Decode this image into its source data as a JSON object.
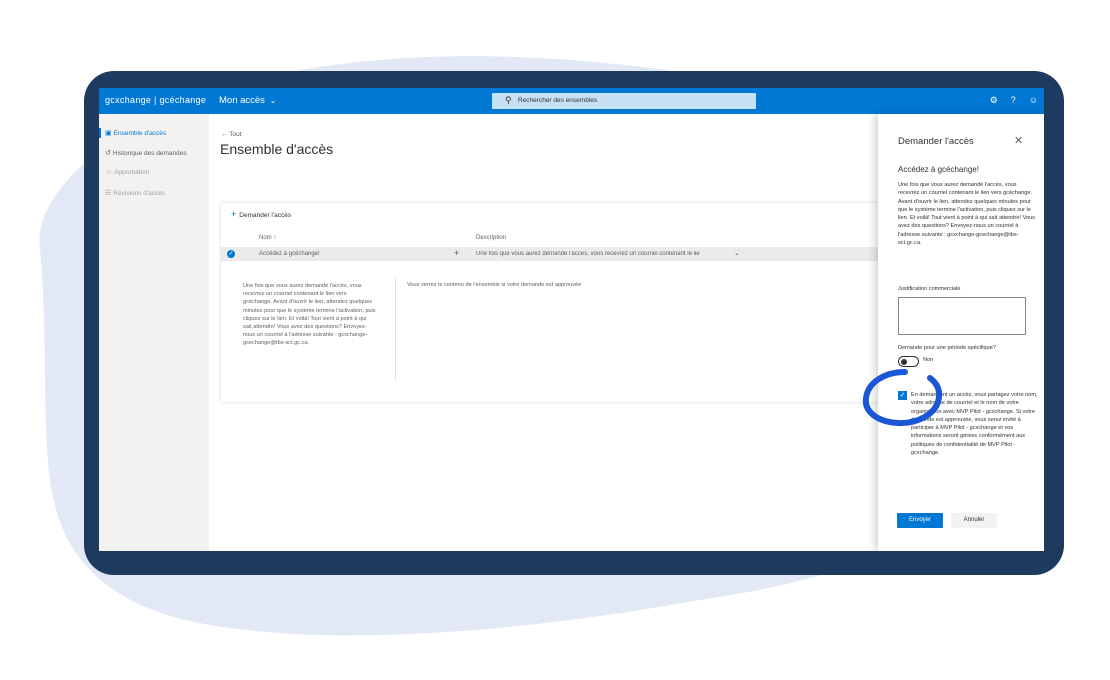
{
  "topbar": {
    "brand": "gcxchange | gcéchange",
    "app_name": "Mon accès",
    "search_placeholder": "Rechercher des ensembles"
  },
  "sidebar": {
    "items": [
      {
        "label": "Ensemble d'accès",
        "icon": "briefcase-icon"
      },
      {
        "label": "Historique des demandes",
        "icon": "history-icon"
      },
      {
        "label": "Approbation",
        "icon": "person-icon"
      },
      {
        "label": "Révisions d'accès",
        "icon": "list-icon"
      }
    ]
  },
  "main": {
    "back_label": "Tout",
    "title": "Ensemble d'accès",
    "request_label": "Demander l'accès",
    "columns": [
      "Nom",
      "Description"
    ],
    "row": {
      "name": "Accédez à gcéchange!",
      "description": "Une fois que vous aurez demandé l'accès, vous recevrez un courriel contenant le lie"
    },
    "detail_description": "Une fois que vous aurez demandé l'accès, vous recevrez un courriel contenant le lien vers gcéchange. Avant d'ouvrir le lien, attendez quelques minutes pour que le système termine l'activation, puis cliquez sur le lien. Et voilà! Tout vient à point à qui sait attendre! Vous avez des questions? Envoyez-nous un courriel à l'adresse suivante : gcxchange-gcechange@tbs-sct.gc.ca.",
    "detail_note": "Vous verrez le contenu de l'ensemble si votre demande est approuvée"
  },
  "panel": {
    "title": "Demander l'accès",
    "subtitle": "Accédez à gcéchange!",
    "description": "Une fois que vous aurez demandé l'accès, vous recevrez un courriel contenant le lien vers gcéchange. Avant d'ouvrir le lien, attendez quelques minutes pour que le système termine l'activation, puis cliquez sur le lien. Et voilà! Tout vient à point à qui sait attendre! Vous avez des questions? Envoyez-nous un courriel à l'adresse suivante : gcxchange-gcechange@tbs-sct.gc.ca.",
    "justification_label": "Justification commerciale",
    "period_label": "Demande pour une période spécifique?",
    "toggle_state": "Non",
    "consent_text": "En demandant un accès, vous partagez votre nom, votre adresse de courriel et le nom de votre organisation avec MVP Pilot - gcxchange. Si votre demande est approuvée, vous serez invité à participer à MVP Pilot - gcxchange et vos informations seront gérées conformément aux politiques de confidentialité de MVP Pilot - gcxchange.",
    "consent_checked": true,
    "submit_label": "Envoyer",
    "cancel_label": "Annuler"
  },
  "colors": {
    "brand": "#0078d4",
    "device_frame": "#1e3a5f",
    "backdrop": "#dde4f2",
    "annotation": "#1a56d6"
  }
}
